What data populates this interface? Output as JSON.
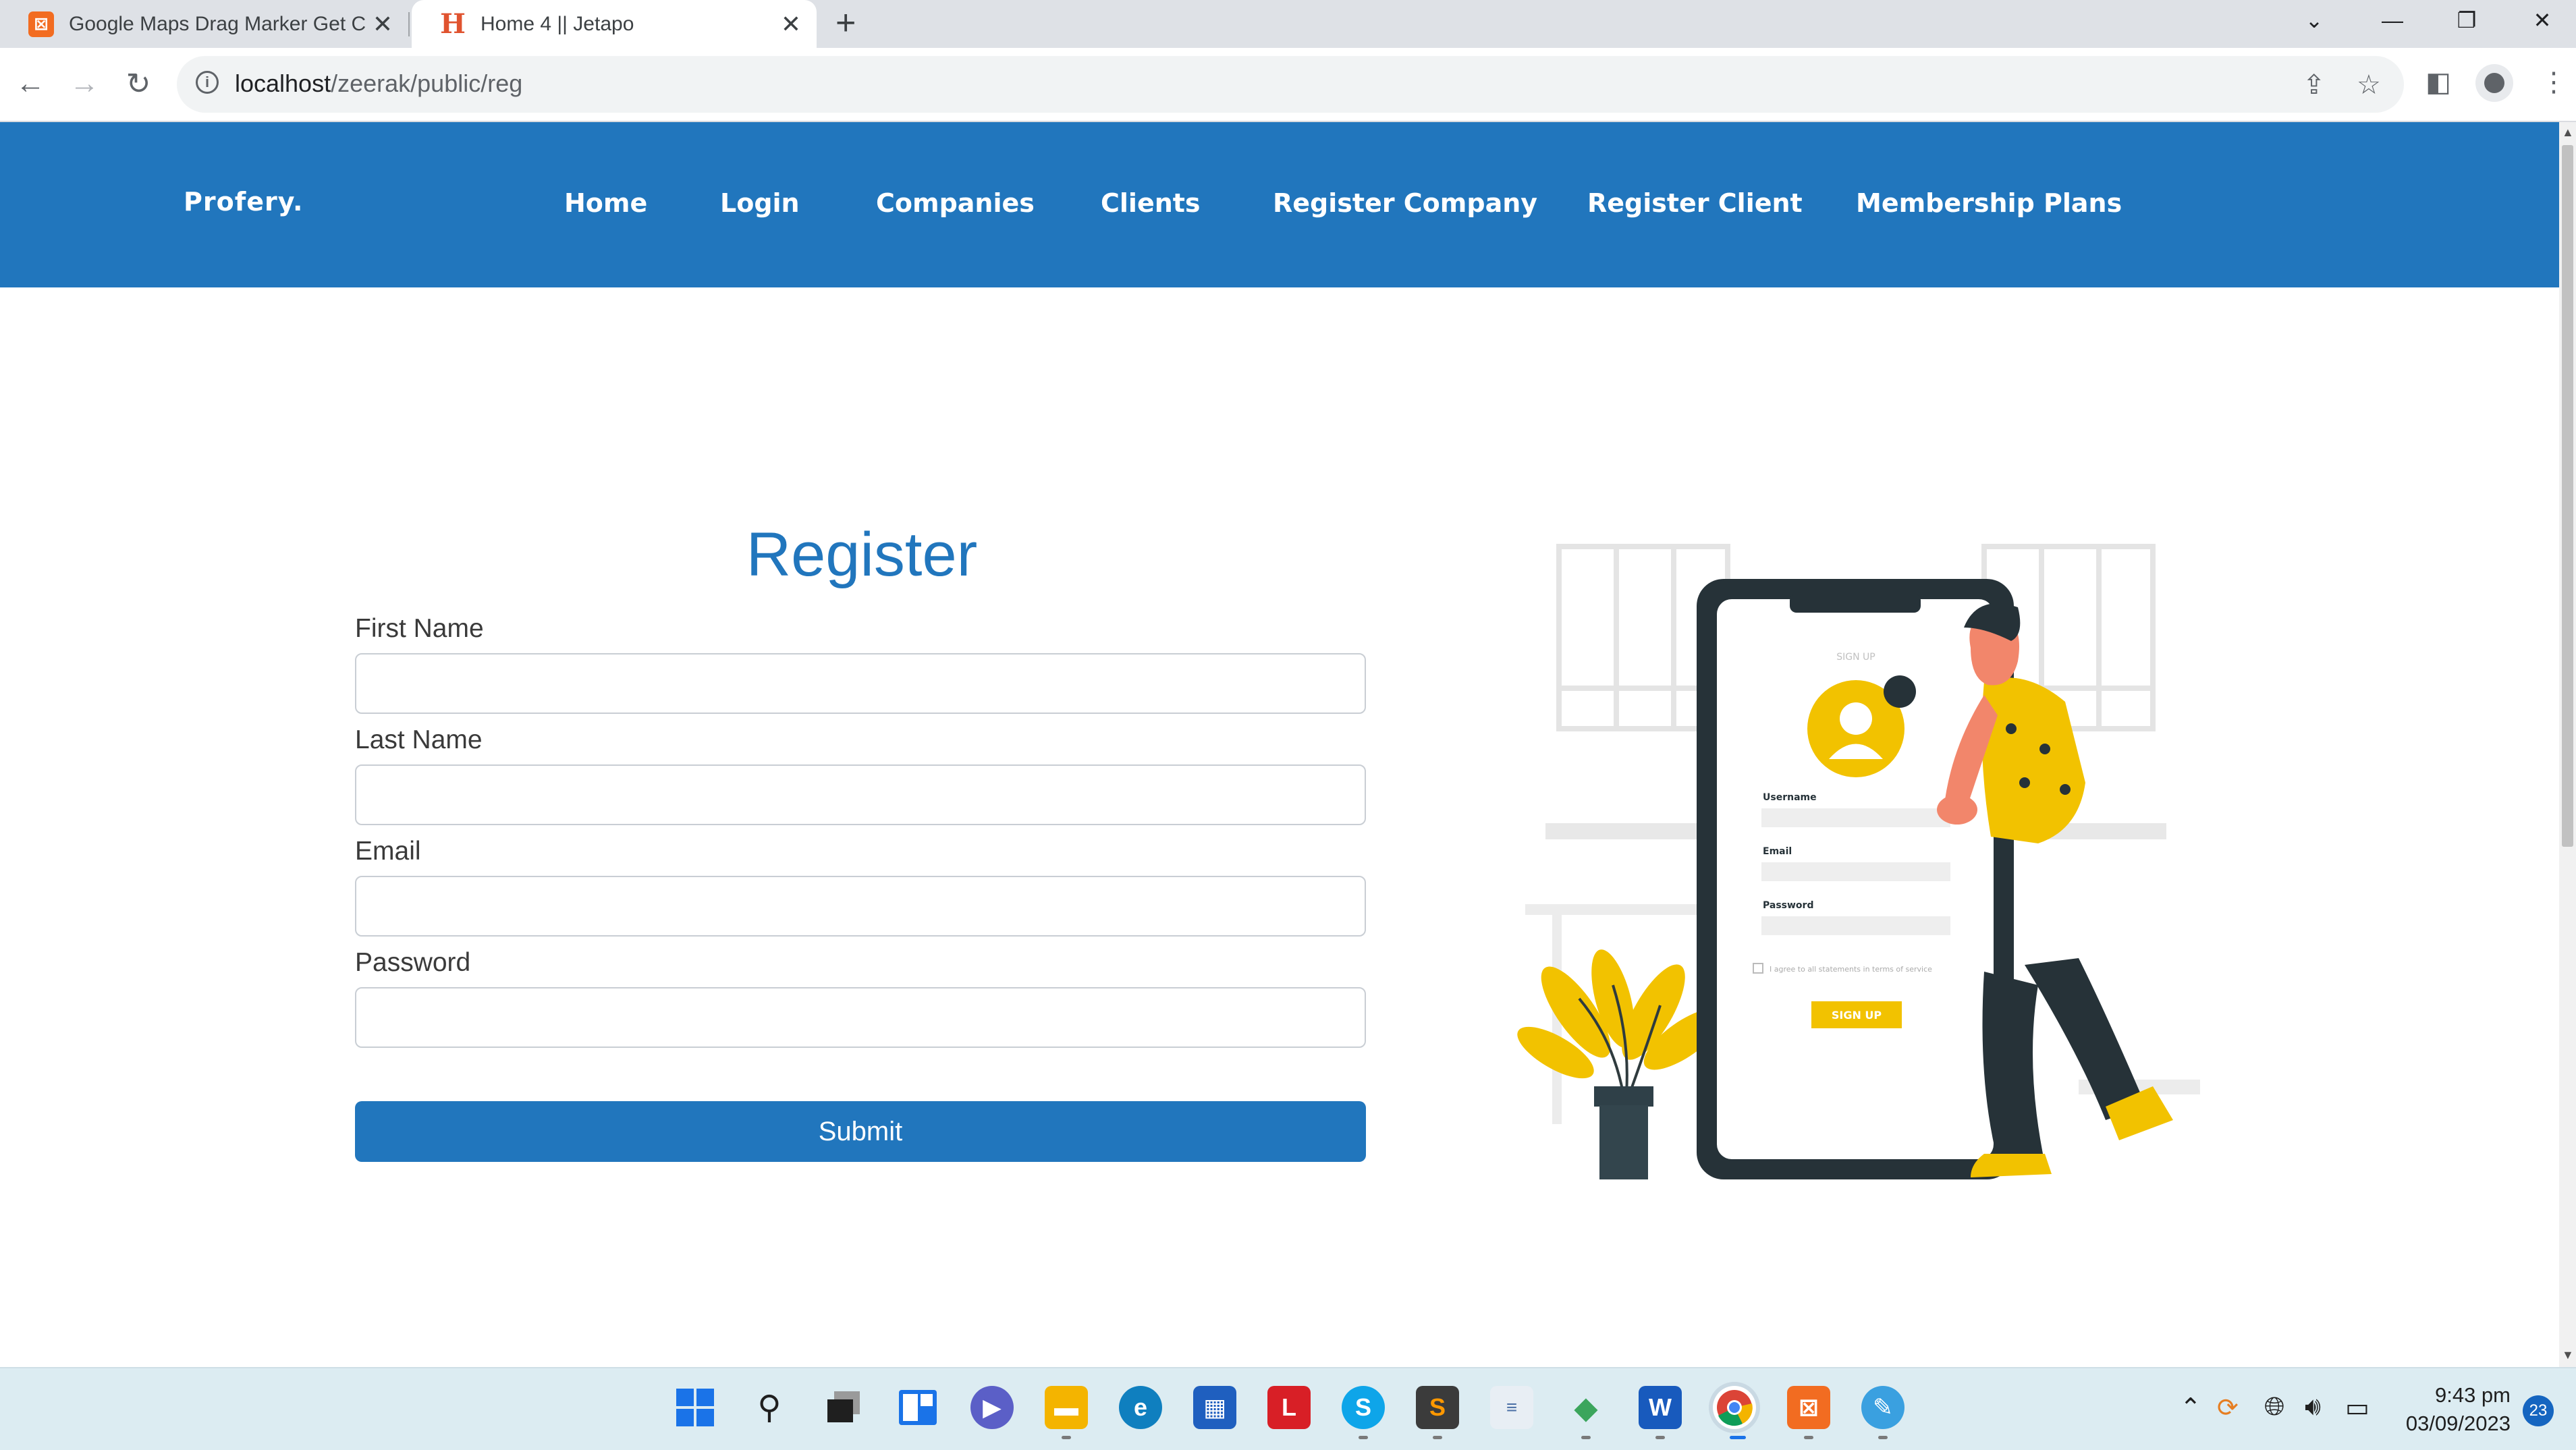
{
  "browser": {
    "tabs": [
      {
        "title": "Google Maps Drag Marker Get C",
        "favicon": "xampp-icon"
      },
      {
        "title": "Home 4 || Jetapo",
        "favicon": "jetapo-h-icon"
      }
    ],
    "url_host": "localhost",
    "url_path": "/zeerak/public/reg"
  },
  "site": {
    "logo": "Profery.",
    "nav": [
      "Home",
      "Login",
      "Companies",
      "Clients",
      "Register Company",
      "Register Client",
      "Membership Plans"
    ],
    "accent_color": "#2176bd"
  },
  "form": {
    "title": "Register",
    "fields": [
      {
        "label": "First Name",
        "value": ""
      },
      {
        "label": "Last Name",
        "value": ""
      },
      {
        "label": "Email",
        "value": ""
      },
      {
        "label": "Password",
        "value": ""
      }
    ],
    "submit_label": "Submit"
  },
  "illustration": {
    "heading": "SIGN UP",
    "username_label": "Username",
    "email_label": "Email",
    "password_label": "Password",
    "terms_text": "I agree to all statements in terms of service",
    "button_label": "SIGN UP"
  },
  "taskbar": {
    "apps": [
      "windows-start-icon",
      "search-icon",
      "task-view-icon",
      "widgets-icon",
      "teams-chat-icon",
      "file-explorer-icon",
      "edge-icon",
      "store-icon",
      "l-app-icon",
      "skype-icon",
      "sublime-text-icon",
      "notepad-icon",
      "git-icon",
      "word-icon",
      "chrome-icon",
      "xampp-icon",
      "paint-icon"
    ],
    "time": "9:43 pm",
    "date": "03/09/2023",
    "notifications": "23"
  }
}
